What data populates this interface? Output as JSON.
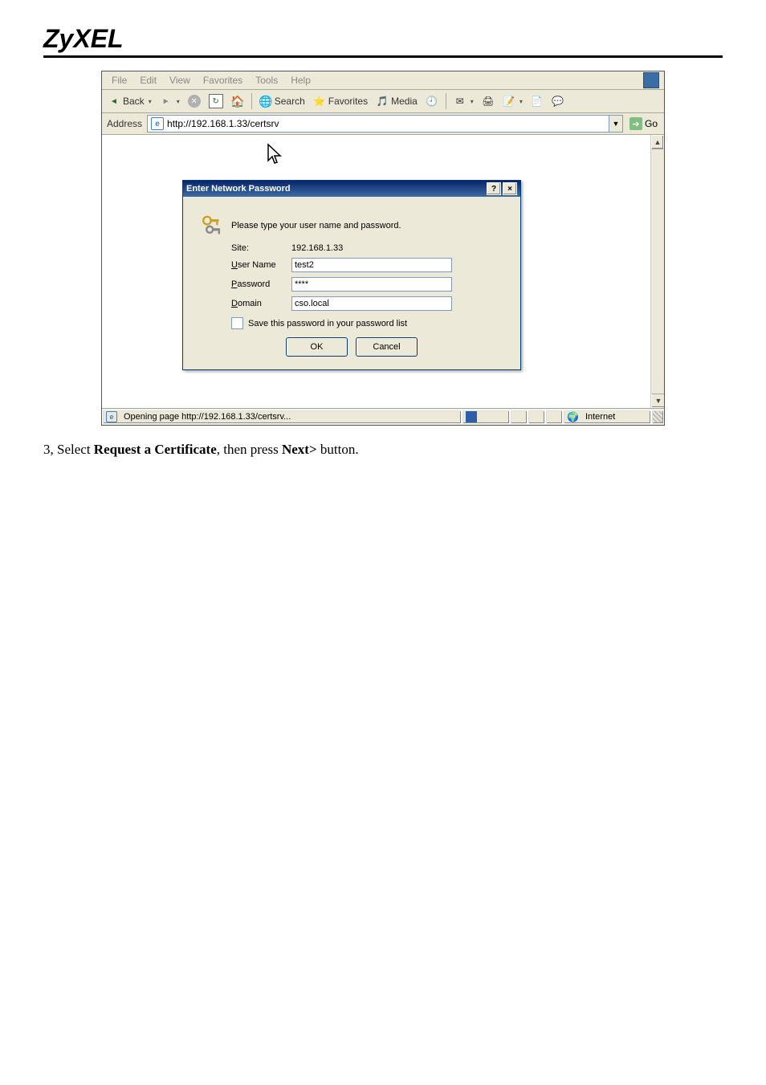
{
  "doc": {
    "logo_text": "ZyXEL",
    "instruction_prefix": "3, Select ",
    "instruction_bold1": "Request a Certificate",
    "instruction_mid": ", then press ",
    "instruction_bold2": "Next>",
    "instruction_suffix": " button."
  },
  "menubar": {
    "items": {
      "file": "File",
      "edit": "Edit",
      "view": "View",
      "favorites": "Favorites",
      "tools": "Tools",
      "help": "Help"
    }
  },
  "toolbar": {
    "back": "Back",
    "search": "Search",
    "favorites": "Favorites",
    "media": "Media"
  },
  "addressbar": {
    "label": "Address",
    "url": "http://192.168.1.33/certsrv",
    "go": "Go"
  },
  "dialog": {
    "title": "Enter Network Password",
    "prompt": "Please type your user name and password.",
    "site_label": "Site:",
    "site_value": "192.168.1.33",
    "user_label_pre": "U",
    "user_label_rest": "ser Name",
    "user_value": "test2",
    "password_label_pre": "P",
    "password_label_rest": "assword",
    "password_value": "****",
    "domain_label_pre": "D",
    "domain_label_rest": "omain",
    "domain_value": "cso.local",
    "save_label_pre": "S",
    "save_label_rest": "ave this password in your password list",
    "ok": "OK",
    "cancel": "Cancel",
    "help_btn": "?",
    "close_btn": "×"
  },
  "statusbar": {
    "message": "Opening page http://192.168.1.33/certsrv...",
    "zone": "Internet"
  }
}
